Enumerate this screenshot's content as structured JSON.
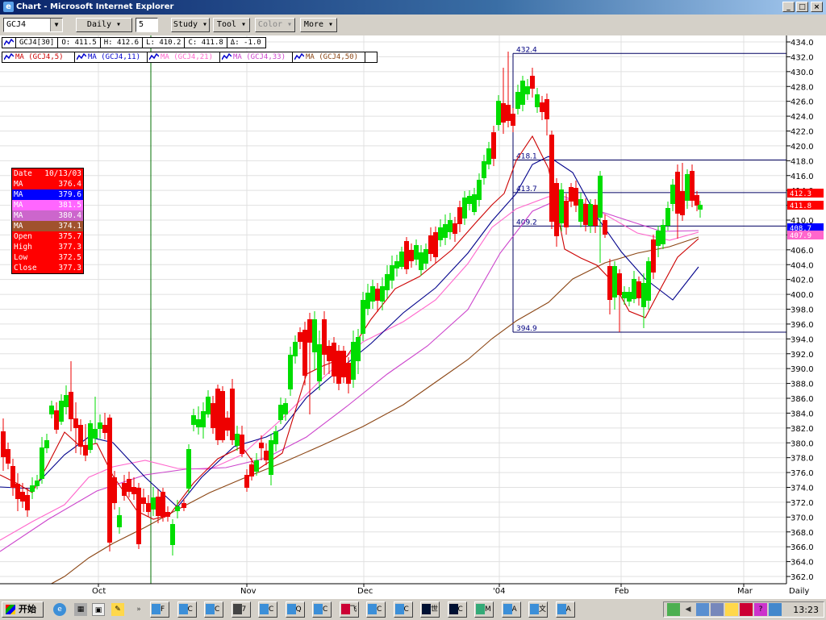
{
  "window": {
    "title": "Chart - Microsoft Internet Explorer",
    "controls": [
      "_",
      "□",
      "×"
    ]
  },
  "toolbar": {
    "symbol": "GCJ4",
    "period_label": "Daily",
    "period_value": "5",
    "study_label": "Study",
    "tool_label": "Tool",
    "color_label": "Color",
    "more_label": "More"
  },
  "quote": {
    "symbol": "GCJ4[30]",
    "open": "O: 411.5",
    "high": "H: 412.6",
    "low": "L: 410.2",
    "close": "C: 411.8",
    "change": "Δ: -1.0"
  },
  "ma_legend": [
    {
      "label": "MA (GCJ4,5)",
      "color": "#cc0000"
    },
    {
      "label": "MA (GCJ4,11)",
      "color": "#0000cc"
    },
    {
      "label": "MA (GCJ4,21)",
      "color": "#ff66cc"
    },
    {
      "label": "MA (GCJ4,33)",
      "color": "#cc44cc"
    },
    {
      "label": "MA (GCJ4,50)",
      "color": "#8b4513"
    }
  ],
  "data_panel": [
    {
      "label": "Date",
      "value": "10/13/03",
      "bg": "#ff0000"
    },
    {
      "label": "MA",
      "value": "376.4",
      "bg": "#ff0000"
    },
    {
      "label": "MA",
      "value": "379.6",
      "bg": "#0000ff"
    },
    {
      "label": "MA",
      "value": "381.5",
      "bg": "#ff66ff"
    },
    {
      "label": "MA",
      "value": "380.4",
      "bg": "#cc66cc"
    },
    {
      "label": "MA",
      "value": "374.1",
      "bg": "#a0522d"
    },
    {
      "label": "Open",
      "value": "375.7",
      "bg": "#ff0000"
    },
    {
      "label": "High",
      "value": "377.3",
      "bg": "#ff0000"
    },
    {
      "label": "Low",
      "value": "372.5",
      "bg": "#ff0000"
    },
    {
      "label": "Close",
      "value": "377.3",
      "bg": "#ff0000"
    }
  ],
  "chart_data": {
    "type": "candlestick",
    "ylim": [
      361,
      434.7
    ],
    "y_ticks": [
      362,
      364,
      366,
      368,
      370,
      372,
      374,
      376,
      378,
      380,
      382,
      384,
      386,
      388,
      390,
      392,
      394,
      396,
      398,
      400,
      402,
      404,
      406,
      408,
      410,
      412,
      414,
      416,
      418,
      420,
      422,
      424,
      426,
      428,
      430,
      432,
      434
    ],
    "x_labels": [
      "Oct",
      "Nov",
      "Dec",
      "'04",
      "Feb",
      "Mar"
    ],
    "x_axis_label": "Daily",
    "crosshair_date": "10/13/03",
    "fib_levels": [
      432.4,
      418.1,
      413.7,
      409.2,
      394.9
    ],
    "price_tags": [
      {
        "value": "412.3",
        "color": "#ff0000"
      },
      {
        "value": "411.8",
        "color": "#ff0000"
      },
      {
        "value": "408.7",
        "color": "#0000ff"
      },
      {
        "value": "407.9",
        "color": "#ff66cc"
      }
    ]
  },
  "taskbar": {
    "start_label": "开始",
    "clock": "13:23",
    "tasks": [
      "F",
      "C",
      "C",
      "7",
      "C",
      "Q",
      "C",
      "飞",
      "C",
      "C",
      "世",
      "C",
      "M",
      "A",
      "文",
      "A"
    ]
  }
}
